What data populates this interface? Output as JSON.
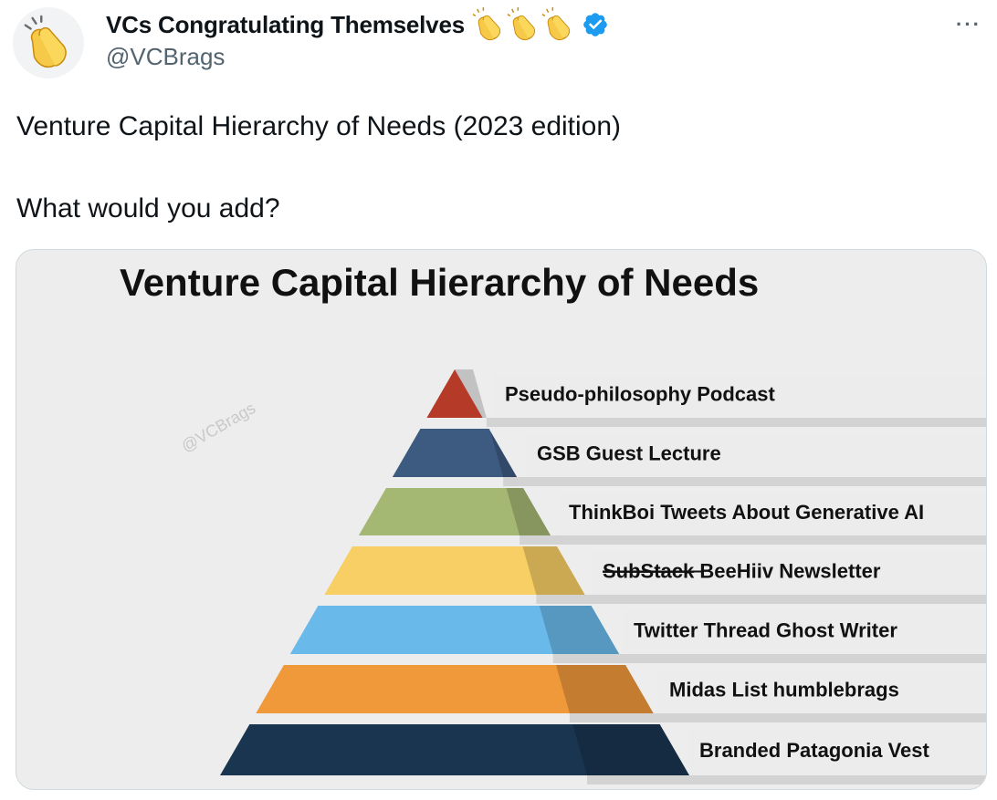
{
  "tweet": {
    "display_name": "VCs Congratulating Themselves",
    "name_emojis": [
      "clapping-hands",
      "clapping-hands",
      "clapping-hands"
    ],
    "verified": true,
    "handle": "@VCBrags",
    "more_icon": "more-options-icon",
    "text_lines": [
      "Venture Capital Hierarchy of Needs (2023 edition)",
      "What would you add?"
    ]
  },
  "image": {
    "title": "Venture Capital Hierarchy of Needs",
    "watermark": "@VCBrags",
    "tiers": [
      {
        "label": "Pseudo-philosophy Podcast",
        "strike": "",
        "color": "#b53a28"
      },
      {
        "label": "GSB Guest Lecture",
        "strike": "",
        "color": "#3d5a80"
      },
      {
        "label": "ThinkBoi Tweets About Generative AI",
        "strike": "",
        "color": "#a5b873"
      },
      {
        "label": " BeeHiiv Newsletter",
        "strike": "SubStack",
        "color": "#f8cf64"
      },
      {
        "label": "Twitter Thread Ghost Writer",
        "strike": "",
        "color": "#69baea"
      },
      {
        "label": "Midas List humblebrags",
        "strike": "",
        "color": "#f0993b"
      },
      {
        "label": "Branded Patagonia Vest",
        "strike": "",
        "color": "#1a3550"
      }
    ]
  }
}
